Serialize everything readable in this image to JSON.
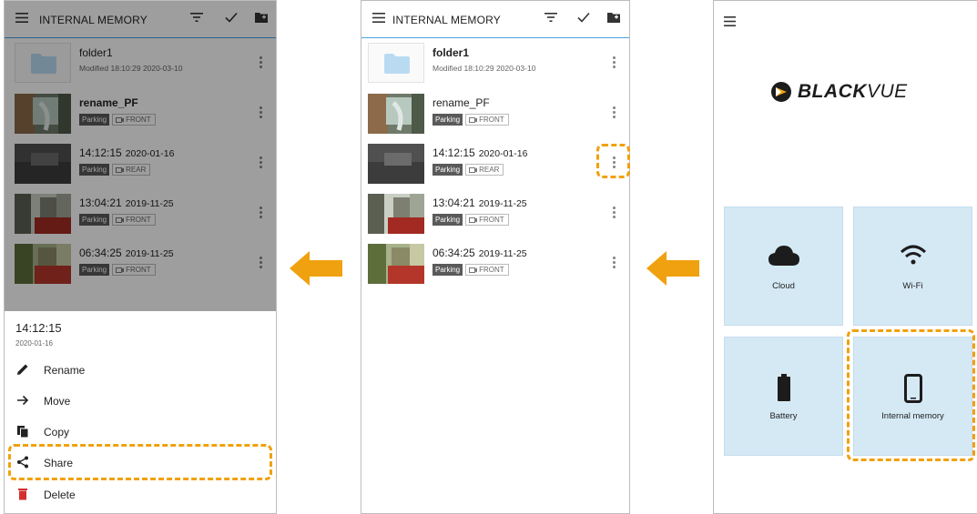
{
  "explorer": {
    "title": "INTERNAL MEMORY",
    "files": [
      {
        "name": "folder1",
        "subtitle": "Modified 18:10:29 2020-03-10",
        "bold": true
      },
      {
        "name": "rename_PF",
        "tag": "Parking",
        "camera": "FRONT"
      },
      {
        "name": "14:12:15",
        "date": "2020-01-16",
        "tag": "Parking",
        "camera": "REAR"
      },
      {
        "name": "13:04:21",
        "date": "2019-11-25",
        "tag": "Parking",
        "camera": "FRONT"
      },
      {
        "name": "06:34:25",
        "date": "2019-11-25",
        "tag": "Parking",
        "camera": "FRONT"
      }
    ],
    "first_screen_bold": "rename_PF"
  },
  "sheet": {
    "title": "14:12:15",
    "date": "2020-01-16",
    "items": [
      {
        "label": "Rename",
        "icon": "pencil-icon"
      },
      {
        "label": "Move",
        "icon": "arrow-right-icon"
      },
      {
        "label": "Copy",
        "icon": "copy-icon"
      },
      {
        "label": "Share",
        "icon": "share-icon"
      },
      {
        "label": "Delete",
        "icon": "trash-icon"
      }
    ]
  },
  "home": {
    "brand_a": "BLACK",
    "brand_b": "VUE",
    "tiles": [
      {
        "label": "Cloud",
        "icon": "cloud-icon"
      },
      {
        "label": "Wi-Fi",
        "icon": "wifi-icon"
      },
      {
        "label": "Battery",
        "icon": "battery-icon"
      },
      {
        "label": "Internal memory",
        "icon": "phone-icon"
      }
    ]
  },
  "colors": {
    "highlight": "#f0a10f",
    "accent_line": "#4aa3df",
    "tile": "#d5e9f5",
    "delete": "#d32f2f"
  }
}
